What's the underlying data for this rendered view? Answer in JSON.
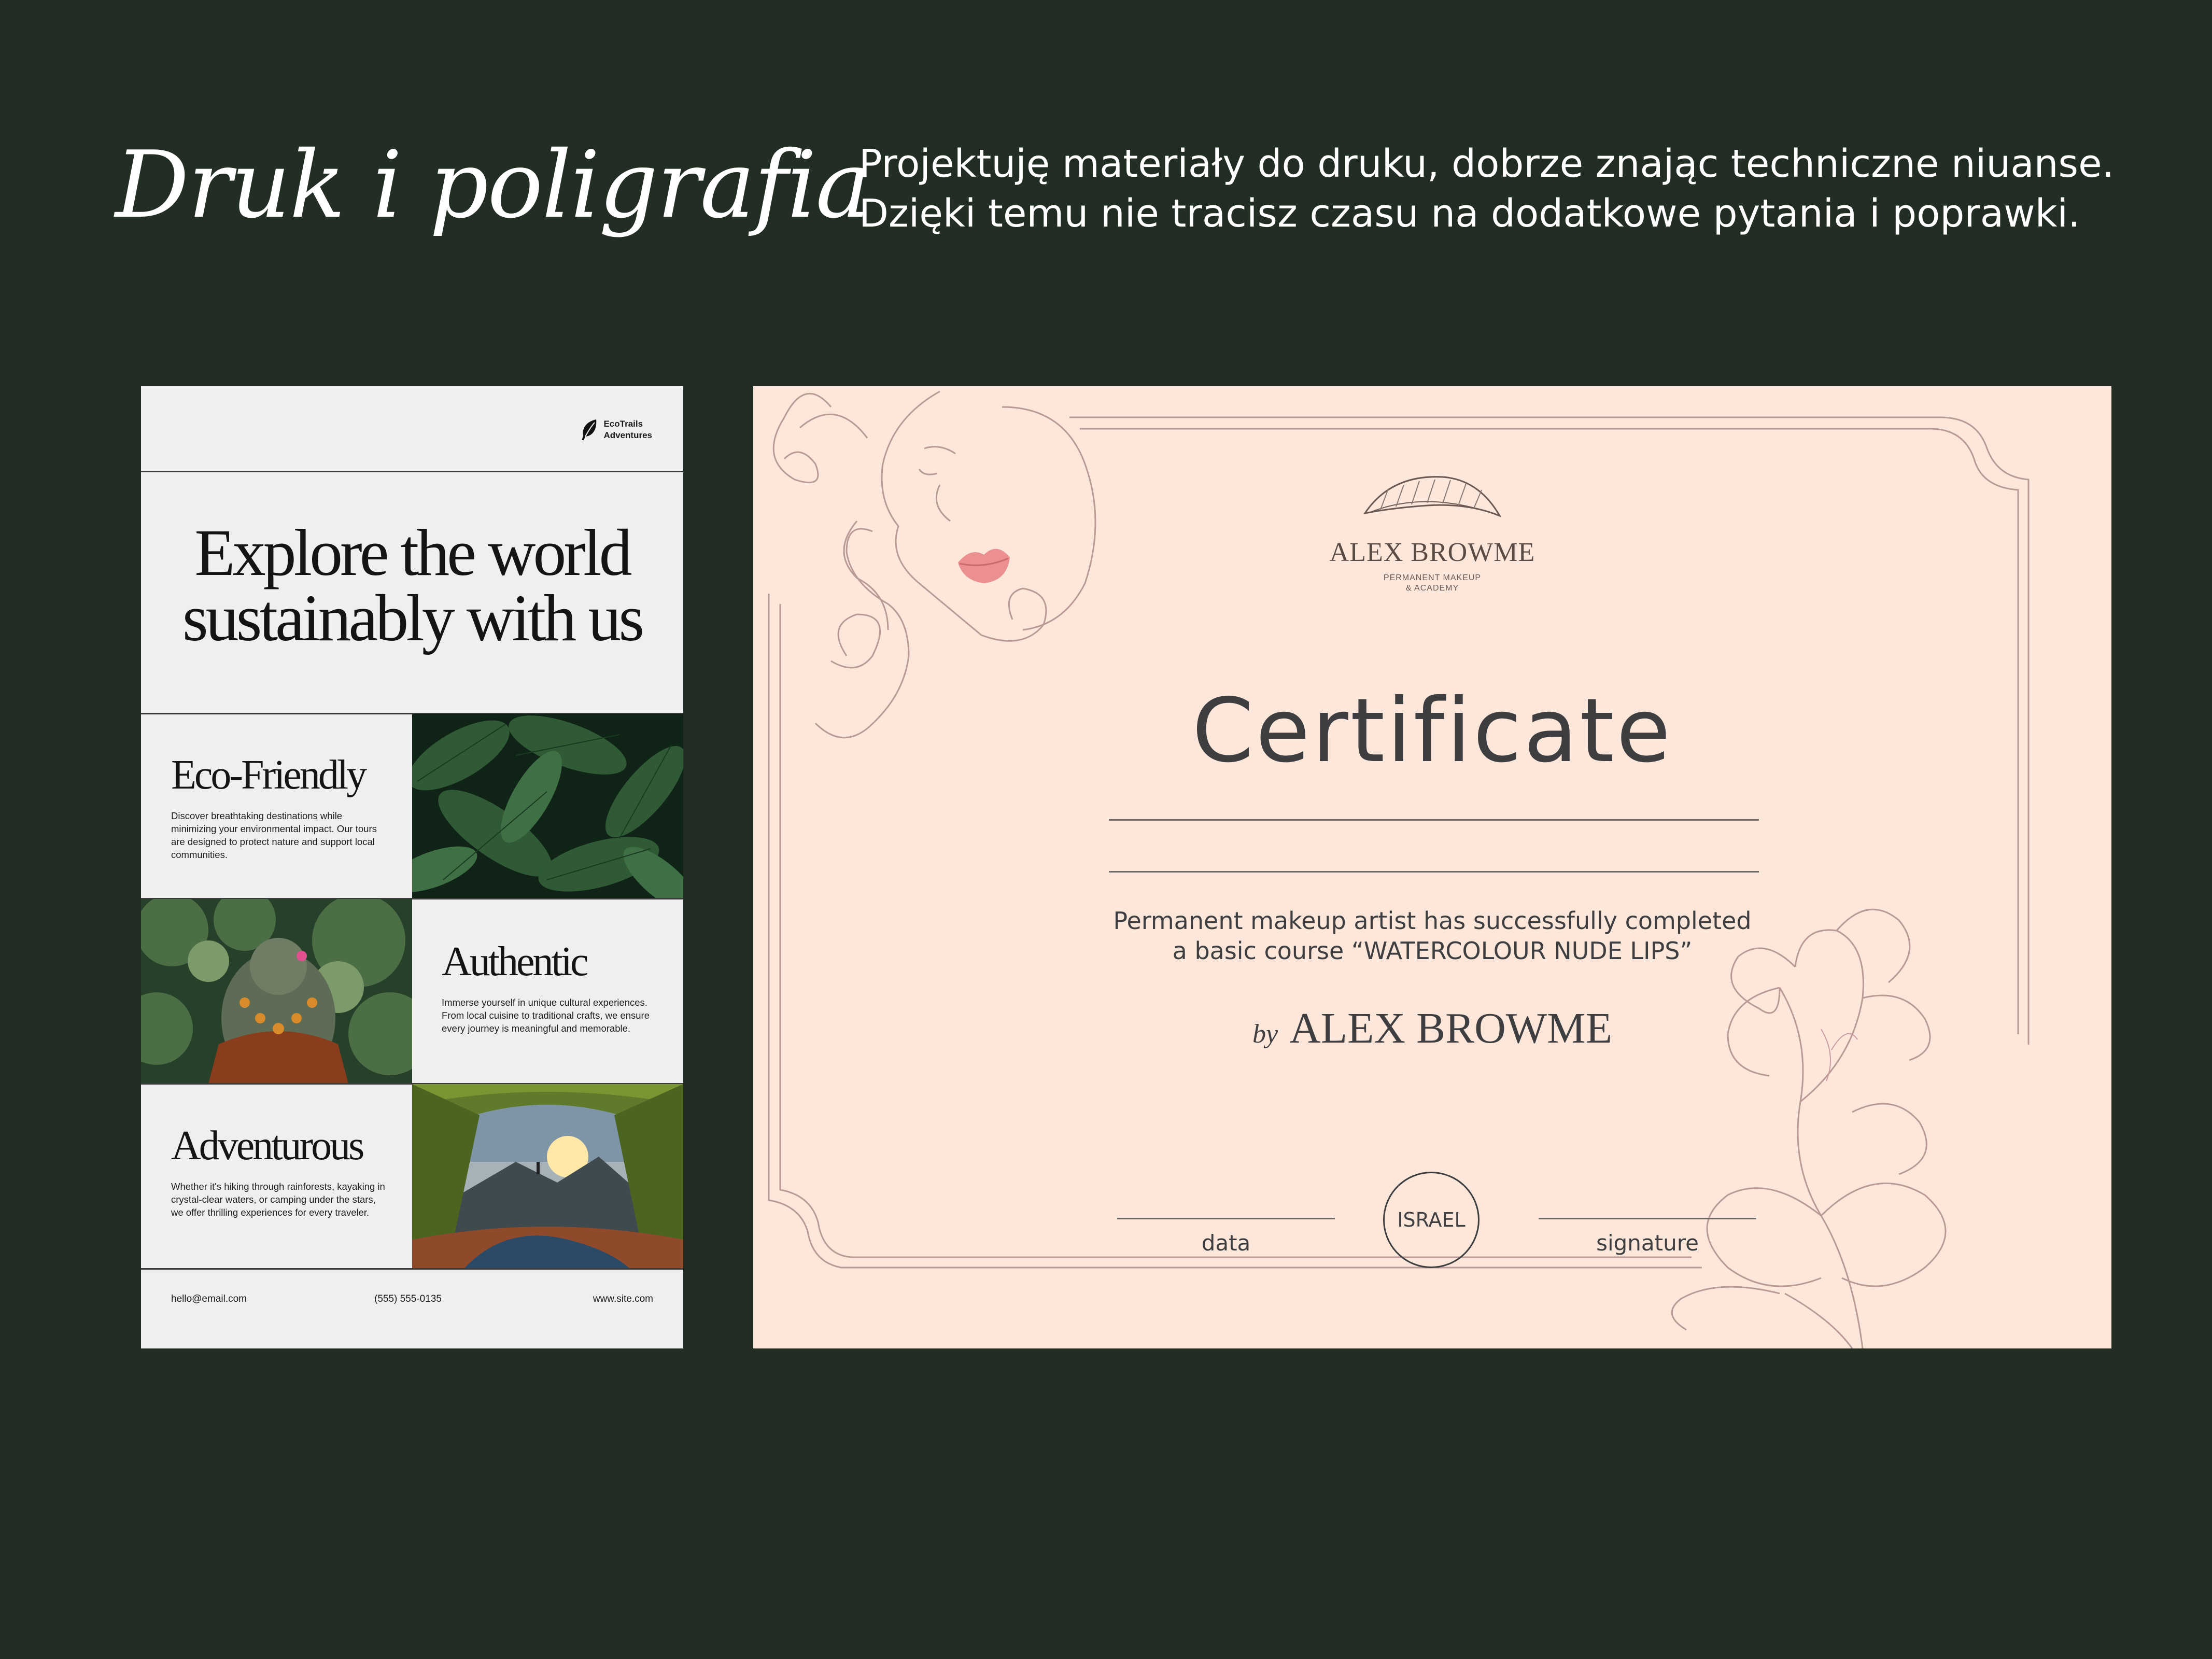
{
  "header": {
    "title": "Druk i poligrafia",
    "intro_lines": [
      "Projektuję materiały do druku, dobrze znając techniczne niuanse.",
      "Dzięki temu nie tracisz czasu na dodatkowe pytania i poprawki."
    ]
  },
  "poster": {
    "brand_lines": [
      "EcoTrails",
      "Adventures"
    ],
    "title_lines": [
      "Explore the world",
      "sustainably with us"
    ],
    "features": [
      {
        "title": "Eco-Friendly",
        "text": "Discover breathtaking destinations while minimizing your environmental impact. Our tours are designed to protect nature and support local communities."
      },
      {
        "title": "Authentic",
        "text": "Immerse yourself in unique cultural experiences. From local cuisine to traditional crafts, we ensure every journey is meaningful and memorable."
      },
      {
        "title": "Adventurous",
        "text": "Whether it's hiking through rainforests, kayaking in crystal-clear waters, or camping under the stars, we offer thrilling experiences for every traveler."
      }
    ],
    "footer": {
      "email": "hello@email.com",
      "phone": "(555) 555-0135",
      "site": "www.site.com"
    }
  },
  "certificate": {
    "logo_name": "ALEX BROWME",
    "logo_sub": [
      "PERMANENT MAKEUP",
      "& ACADEMY"
    ],
    "title": "Certificate",
    "description_lines": [
      "Permanent makeup artist has successfully completed",
      "a basic course “WATERCOLOUR  NUDE LIPS”"
    ],
    "by": "by",
    "author": "ALEX BROWME",
    "date_label": "data",
    "stamp": "ISRAEL",
    "signature_label": "signature"
  },
  "colors": {
    "background": "#222e24",
    "poster_bg": "#efefef",
    "certificate_bg": "#fde7da",
    "certificate_line": "#b99a94",
    "lips": "#e8878a"
  }
}
